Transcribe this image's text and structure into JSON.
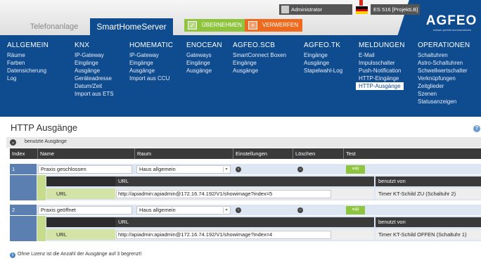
{
  "header": {
    "tab_telefonanlage": "Telefonanlage",
    "tab_smarthome": "SmartHomeServer",
    "accept_label": "ÜBERNEHMEN",
    "reject_label": "VERWERFEN",
    "user": "Administrator",
    "system": "ES 516 [ProjektLB]",
    "logo": "AGFEO",
    "logo_sub": "einfach perfekt kommunizieren"
  },
  "nav": [
    {
      "title": "ALLGEMEIN",
      "items": [
        "Räume",
        "Farben",
        "Datensicherung",
        "Log"
      ]
    },
    {
      "title": "KNX",
      "items": [
        "IP-Gateway",
        "Eingänge",
        "Ausgänge",
        "Geräteadresse",
        "Datum/Zeit",
        "Import aus ETS"
      ]
    },
    {
      "title": "HOMEMATIC",
      "items": [
        "IP-Gateway",
        "Eingänge",
        "Ausgänge",
        "Import aus CCU"
      ]
    },
    {
      "title": "ENOCEAN",
      "items": [
        "Gateways",
        "Eingänge",
        "Ausgänge"
      ]
    },
    {
      "title": "AGFEO.SCB",
      "items": [
        "SmartConnect Boxen",
        "Eingänge",
        "Ausgänge"
      ]
    },
    {
      "title": "AGFEO.TK",
      "items": [
        "Eingänge",
        "Ausgänge",
        "Stapelwahl-Log"
      ]
    },
    {
      "title": "MELDUNGEN",
      "items": [
        "E-Mail",
        "Impulsschalter",
        "Push-Notification",
        "HTTP-Eingänge",
        "HTTP-Ausgänge"
      ]
    },
    {
      "title": "OPERATIONEN",
      "items": [
        "Schaltuhren",
        "Astro-Schaltuhren",
        "Schwellwertschalter",
        "Verknüpfungen",
        "Zeitglieder",
        "Szenen",
        "Statusanzeigen"
      ]
    }
  ],
  "page": {
    "title": "HTTP Ausgänge",
    "subbar": "benutzte Ausgänge",
    "note": "Ohne Lizenz ist die Anzahl der Ausgänge auf 3 begrenzt!"
  },
  "table": {
    "headers": [
      "Index",
      "Name",
      "Raum",
      "Einstellungen",
      "Löschen",
      "Test"
    ],
    "url_header": "URL",
    "url_label": "URL",
    "used_by_header": "benutzt von",
    "rows": [
      {
        "index": "1",
        "name": "Praxis geschlossen",
        "room": "Haus allgemein",
        "url": "http://apiadmin:apiadmin@172.16.74.192/V1/showimage?index=5",
        "used_by": "Timer KT-Schild ZU (Schaltuhr 2)"
      },
      {
        "index": "2",
        "name": "Praxis geöffnet",
        "room": "Haus allgemein",
        "url": "http://apiadmin:apiadmin@172.16.74.192/V1/showimage?index=4",
        "used_by": "Timer KT-Schild OFFEN (Schaltuhr 1)"
      }
    ]
  },
  "colors": {
    "brand_blue": "#0e4b8f",
    "accept_green": "#8fc43e",
    "reject_orange": "#ee6a1e",
    "header_dark": "#3a3a3a"
  }
}
